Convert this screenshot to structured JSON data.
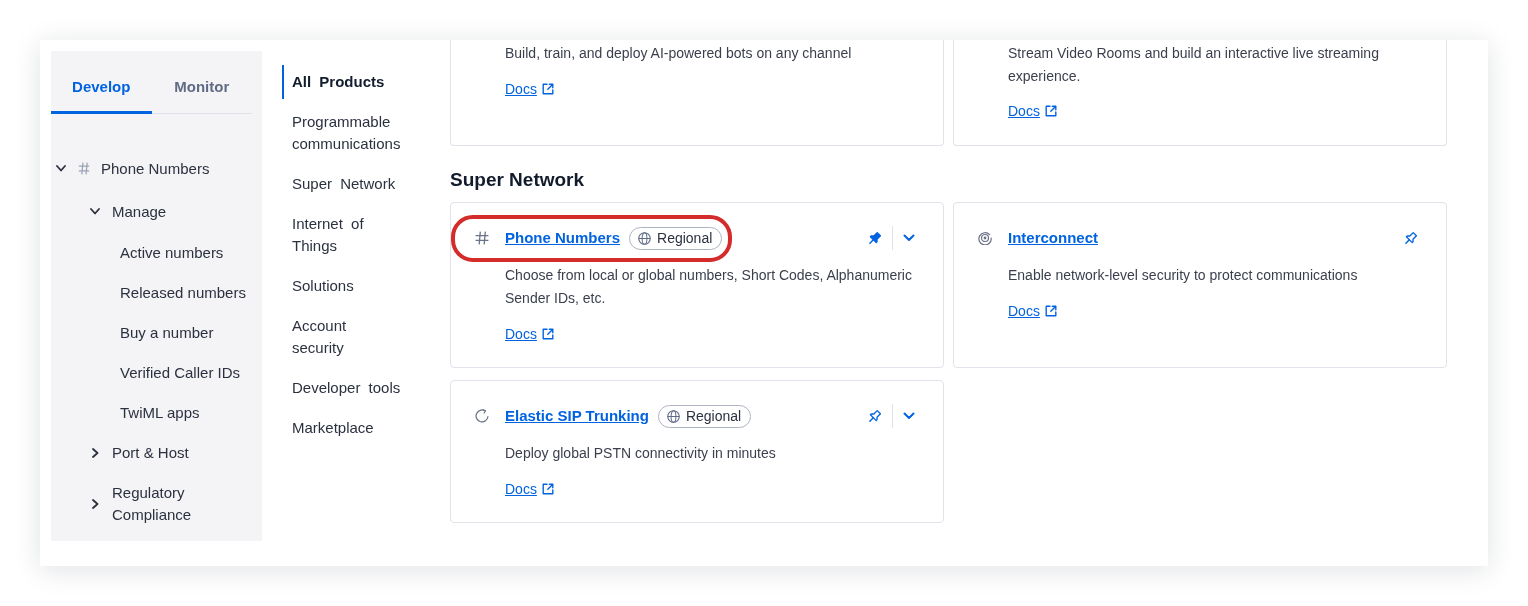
{
  "sidebar": {
    "tabs": [
      {
        "label": "Develop",
        "selected": true
      },
      {
        "label": "Monitor",
        "selected": false
      }
    ],
    "tree": [
      {
        "label": "Phone Numbers",
        "kind": "hash",
        "expanded": true,
        "children": [
          {
            "label": "Manage",
            "expanded": true,
            "children": [
              {
                "label": "Active numbers"
              },
              {
                "label": "Released numbers"
              },
              {
                "label": "Buy a number"
              },
              {
                "label": "Verified Caller IDs"
              },
              {
                "label": "TwiML apps"
              }
            ]
          },
          {
            "label": "Port & Host",
            "expanded": false
          },
          {
            "label": "Regulatory Compliance",
            "expanded": false
          }
        ]
      }
    ]
  },
  "category_nav": {
    "items": [
      {
        "label": "All Products",
        "selected": true
      },
      {
        "label": "Programmable communications",
        "selected": false
      },
      {
        "label": "Super Network",
        "selected": false
      },
      {
        "label": "Internet of Things",
        "selected": false
      },
      {
        "label": "Solutions",
        "selected": false
      },
      {
        "label": "Account security",
        "selected": false
      },
      {
        "label": "Developer tools",
        "selected": false
      },
      {
        "label": "Marketplace",
        "selected": false
      }
    ]
  },
  "products": {
    "cards_above": [
      {
        "description": "Build, train, and deploy AI-powered bots on any channel",
        "link": "Docs"
      },
      {
        "description": "Stream Video Rooms and build an interactive live streaming experience.",
        "link": "Docs"
      }
    ],
    "sections": [
      {
        "heading": "Super Network",
        "cards": [
          {
            "kind": "hash",
            "title": "Phone Numbers",
            "badge": "Regional",
            "description": "Choose from local or global numbers, Short Codes, Alphanumeric Sender IDs, etc.",
            "link": "Docs",
            "pinned": true,
            "expandable": true,
            "highlighted": true
          },
          {
            "kind": "rings",
            "title": "Interconnect",
            "description": "Enable network-level security to protect communications",
            "link": "Docs",
            "pinned": false,
            "expandable": false,
            "highlighted": false
          },
          {
            "kind": "sip",
            "title": "Elastic SIP Trunking",
            "badge": "Regional",
            "description": "Deploy global PSTN connectivity in minutes",
            "link": "Docs",
            "pinned": false,
            "expandable": true,
            "highlighted": false
          }
        ]
      }
    ]
  }
}
